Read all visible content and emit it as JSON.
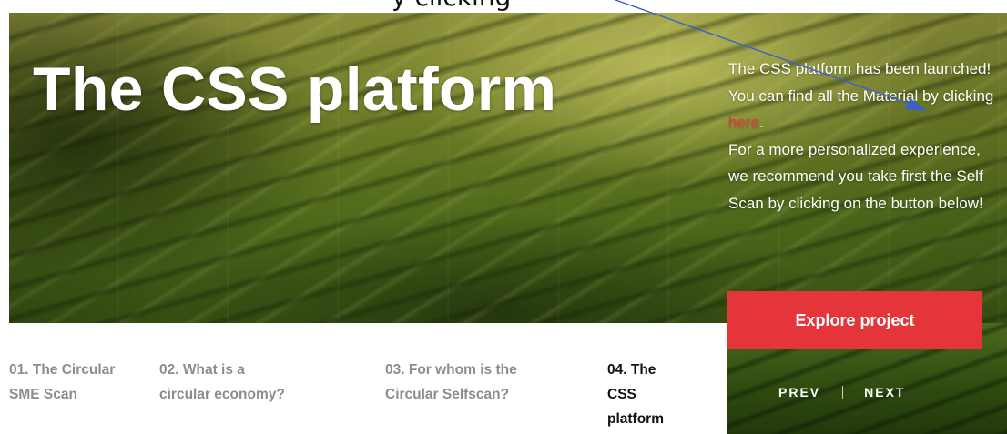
{
  "annotation": {
    "caption_fragment": "y clicking"
  },
  "hero": {
    "title": "The CSS platform"
  },
  "side_panel": {
    "line1": "The CSS platform has been launched! You can find all the Material by clicking ",
    "link_text": "here",
    "line1_end": ".",
    "line2": "For a more personalized experience, we recommend you take first the Self Scan by clicking on the button below!",
    "button_label": "Explore project",
    "prev_label": "PREV",
    "next_label": "NEXT"
  },
  "steps": [
    {
      "label": "01. The Circular SME Scan",
      "active": false
    },
    {
      "label": "02. What is a circular economy?",
      "active": false
    },
    {
      "label": "03. For whom is the Circular Selfscan?",
      "active": false
    },
    {
      "label": "04. The CSS platform",
      "active": true
    }
  ],
  "colors": {
    "accent": "#e4353b",
    "link": "#e8383d",
    "arrow": "#3a5fd0",
    "inactive_step": "#8d8d8d",
    "active_step": "#111111"
  }
}
